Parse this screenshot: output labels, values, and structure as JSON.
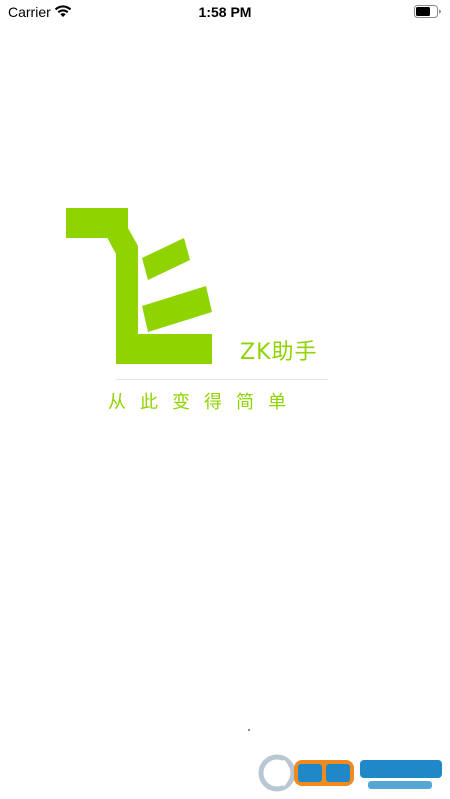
{
  "status_bar": {
    "carrier": "Carrier",
    "time": "1:58 PM",
    "wifi_icon": "wifi-icon",
    "battery_icon": "battery-icon"
  },
  "splash": {
    "logo_icon": "fei-logo-icon",
    "brand_name": "ZK助手",
    "slogan": "从此变得简单"
  },
  "watermark": {
    "logo_icon": "cr173-watermark-logo"
  },
  "colors": {
    "accent": "#8fd400",
    "background": "#ffffff",
    "divider": "#e6e6e6",
    "watermark_blue": "#1e88c8",
    "watermark_orange": "#f08a1e"
  }
}
